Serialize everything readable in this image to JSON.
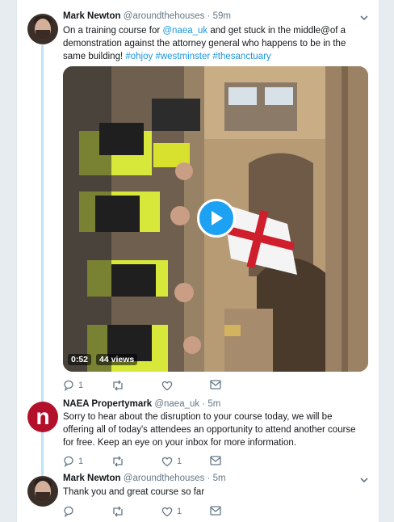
{
  "tweets": [
    {
      "author_name": "Mark Newton",
      "handle": "@aroundthehouses",
      "time": "59m",
      "text_parts": [
        "On a training course for ",
        "@naea_uk",
        " and get stuck in the middle@of a demonstration against the attorney general who happens to be in the same building! ",
        "#ohjoy",
        " ",
        "#westminster",
        " ",
        "#thesanctuary"
      ],
      "video": {
        "duration": "0:52",
        "views": "44 views"
      },
      "actions": {
        "replies": "1",
        "retweets": "",
        "likes": "",
        "dm": ""
      },
      "avatar_icon": "person-avatar"
    },
    {
      "author_name": "NAEA Propertymark",
      "handle": "@naea_uk",
      "time": "5m",
      "avatar_letter": "n",
      "text": "Sorry to hear about the disruption to your course today, we will be offering all of today's attendees an opportunity to attend another course for free. Keep an eye on your inbox for more information.",
      "actions": {
        "replies": "1",
        "retweets": "",
        "likes": "1",
        "dm": ""
      }
    },
    {
      "author_name": "Mark Newton",
      "handle": "@aroundthehouses",
      "time": "5m",
      "text": "Thank you and great course so far",
      "actions": {
        "replies": "",
        "retweets": "",
        "likes": "1",
        "dm": ""
      },
      "avatar_icon": "person-avatar"
    }
  ],
  "colors": {
    "link": "#1b95e0",
    "thread_line": "#bfe3f7",
    "naea_brand": "#b3112b",
    "play_button": "#1da1f2"
  }
}
